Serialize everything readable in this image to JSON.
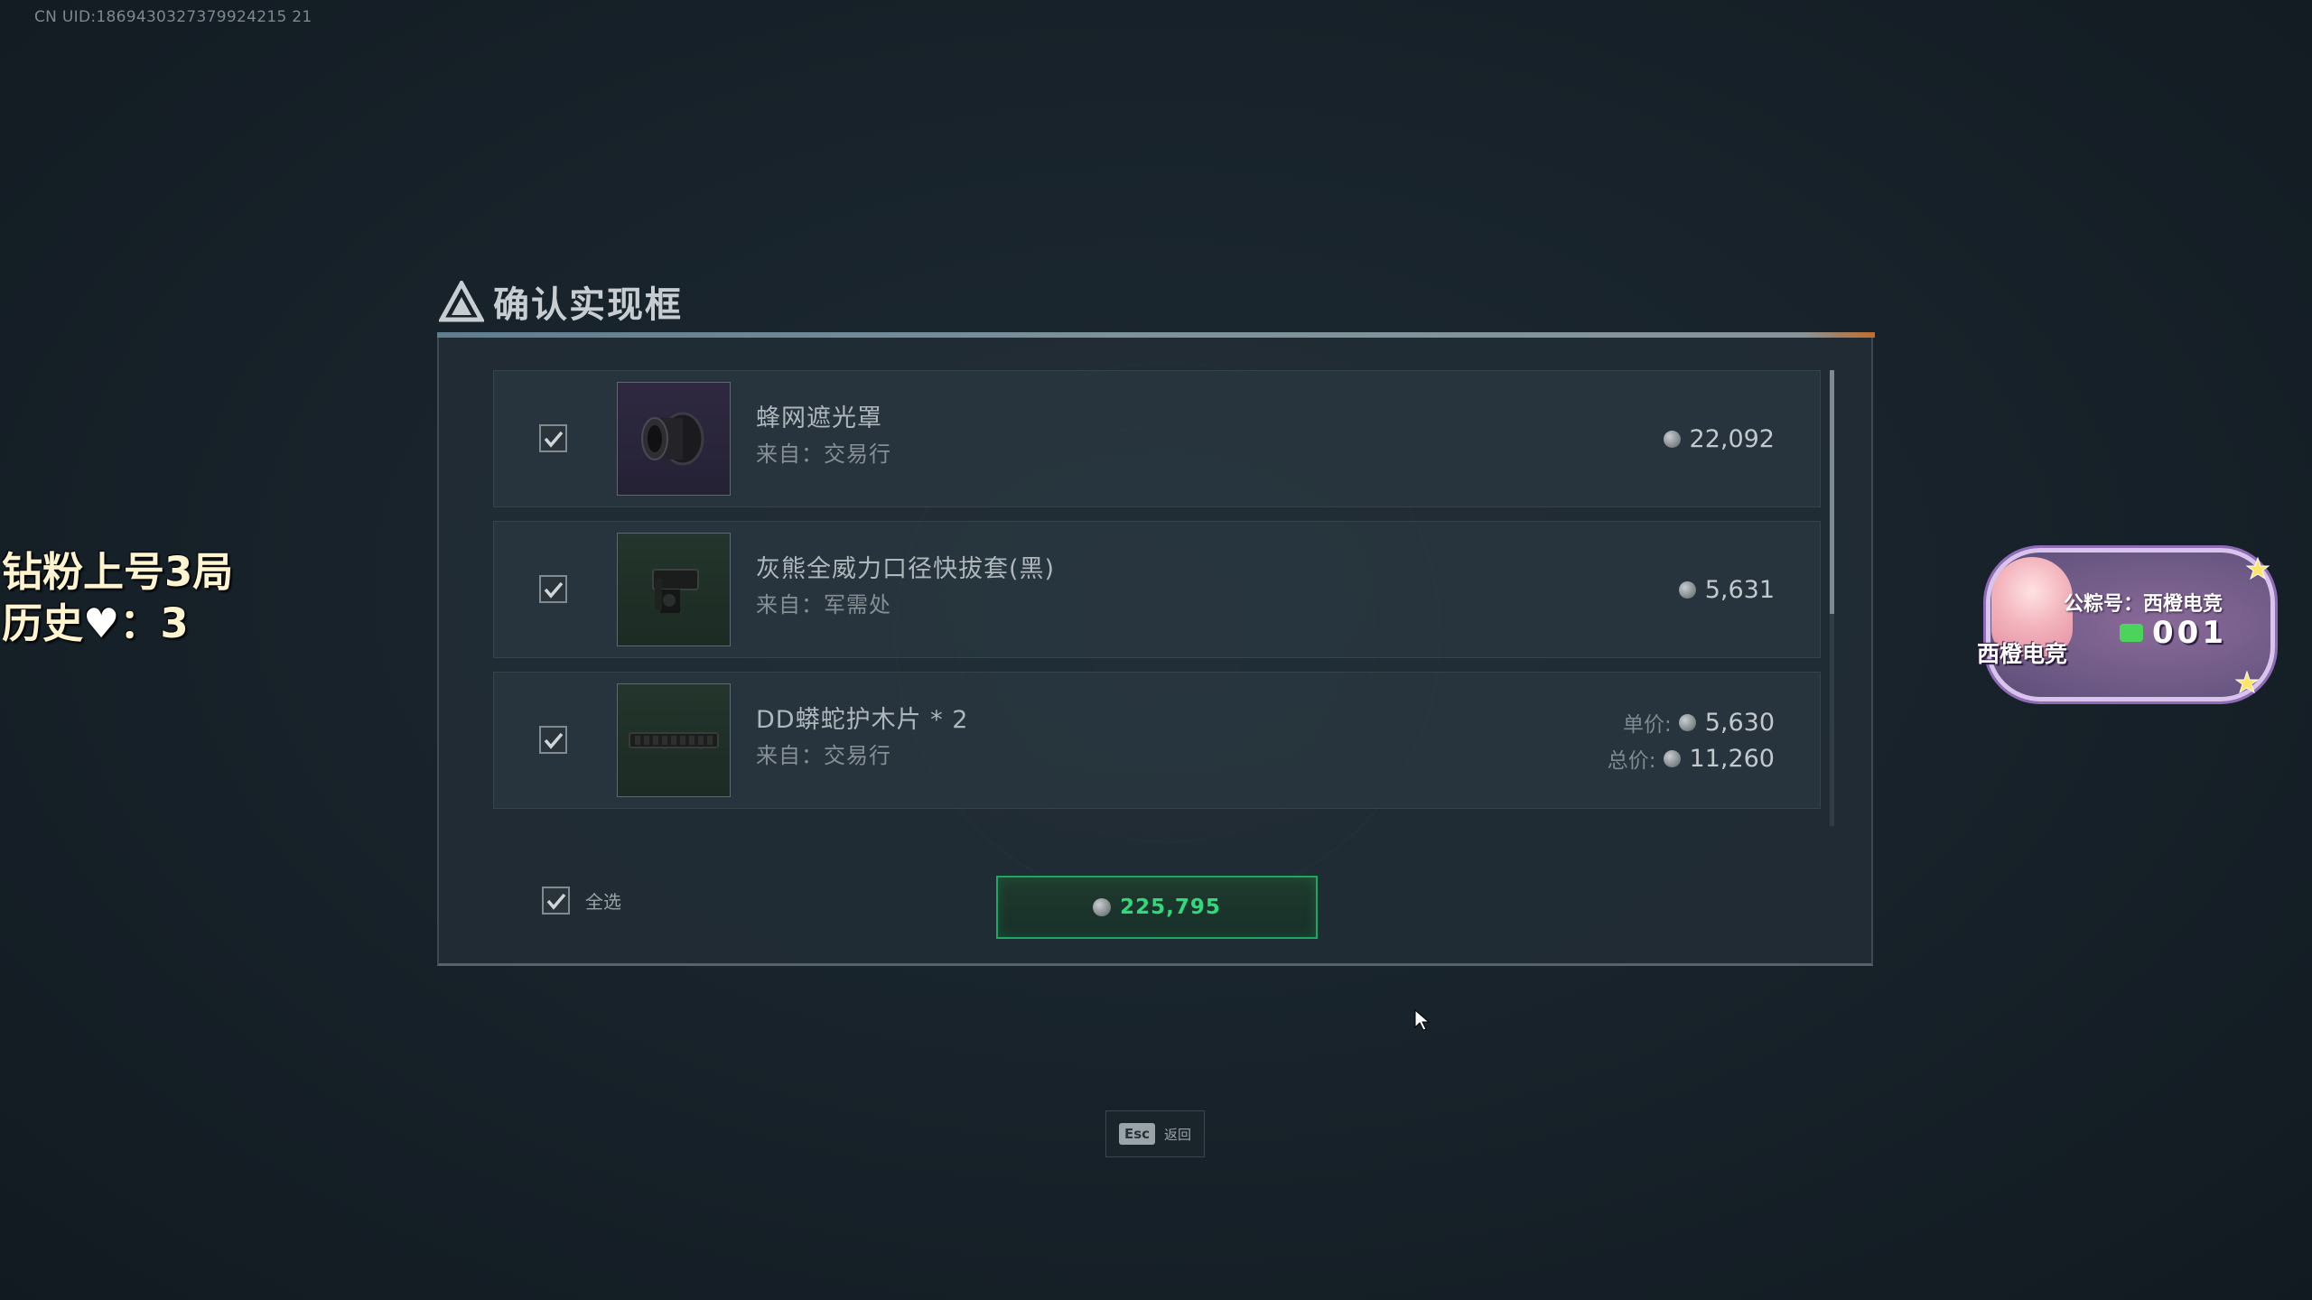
{
  "overlay": {
    "uid": "CN UID:1869430327379924215 21",
    "stream_line1": "钻粉上号3局",
    "stream_line2_prefix": "历史",
    "stream_line2_heart": "♥",
    "stream_line2_suffix": "：3"
  },
  "dialog": {
    "title": "确认实现框",
    "items": [
      {
        "name": "蜂网遮光罩",
        "source": "来自：交易行",
        "price": "22,092",
        "checked": true,
        "thumb_color": "purple",
        "icon": "lens-hood-icon"
      },
      {
        "name": "灰熊全威力口径快拔套(黑)",
        "source": "来自：军需处",
        "price": "5,631",
        "checked": true,
        "thumb_color": "green",
        "icon": "muzzle-adapter-icon"
      },
      {
        "name": "DD蟒蛇护木片 * 2",
        "source": "来自：交易行",
        "unit_label": "单价:",
        "unit_price": "5,630",
        "total_label": "总价:",
        "total_price": "11,260",
        "checked": true,
        "thumb_color": "green",
        "icon": "handguard-panel-icon"
      }
    ],
    "select_all_label": "全选",
    "confirm_total": "225,795"
  },
  "footer": {
    "esc_key": "Esc",
    "esc_label": "返回"
  },
  "badge": {
    "nickname": "公粽号：西橙电竞",
    "name": "西橙电竞",
    "id": "001"
  },
  "colors": {
    "accent_green": "#2fd97c",
    "title_line_end": "#e07a2a",
    "background": "#18232b"
  }
}
